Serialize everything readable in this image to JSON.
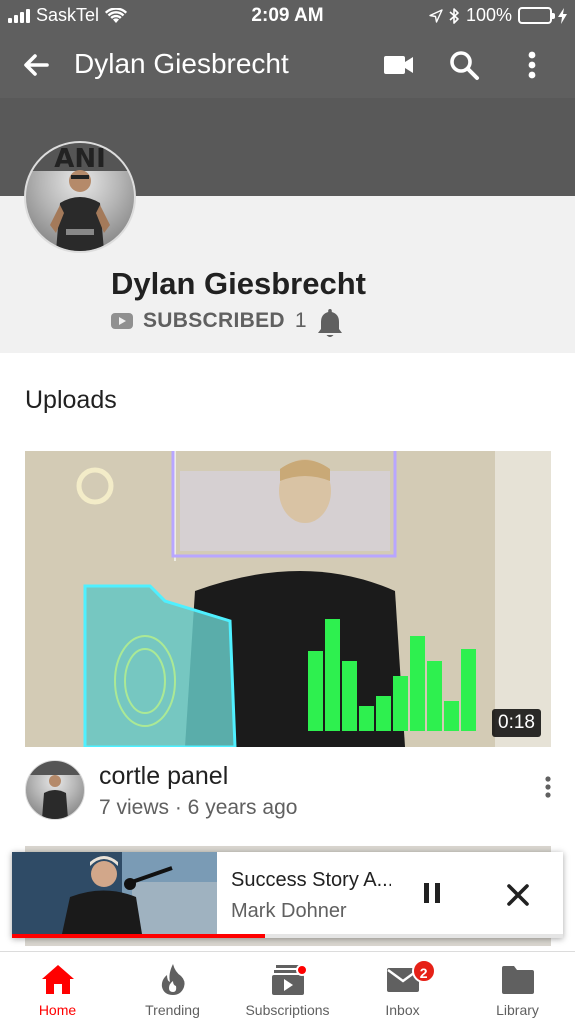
{
  "status_bar": {
    "carrier": "SaskTel",
    "time": "2:09 AM",
    "battery_percent": "100%",
    "battery_level": 1.0
  },
  "app_bar": {
    "title": "Dylan Giesbrecht",
    "icons": [
      "back-arrow-icon",
      "video-camera-icon",
      "search-icon",
      "more-vert-icon"
    ]
  },
  "channel": {
    "name": "Dylan Giesbrecht",
    "subscribed_label": "SUBSCRIBED",
    "subscriber_count": "1",
    "icons": [
      "youtube-icon",
      "bell-icon"
    ]
  },
  "uploads": {
    "heading": "Uploads",
    "videos": [
      {
        "title": "cortle panel",
        "meta": "7 views · 6 years ago",
        "duration": "0:18"
      }
    ]
  },
  "mini_player": {
    "title": "Success Story A...",
    "channel": "Mark Dohner",
    "progress": 0.46,
    "icons": [
      "pause-icon",
      "close-icon"
    ]
  },
  "bottom_nav": {
    "items": [
      {
        "label": "Home",
        "icon": "home-icon",
        "active": true
      },
      {
        "label": "Trending",
        "icon": "flame-icon"
      },
      {
        "label": "Subscriptions",
        "icon": "subscriptions-icon"
      },
      {
        "label": "Inbox",
        "icon": "mail-icon",
        "badge": "2"
      },
      {
        "label": "Library",
        "icon": "folder-icon"
      }
    ]
  },
  "colors": {
    "header_gray": "#5f5f5f",
    "accent_red": "#ff0000",
    "battery_green": "#4cd964"
  }
}
